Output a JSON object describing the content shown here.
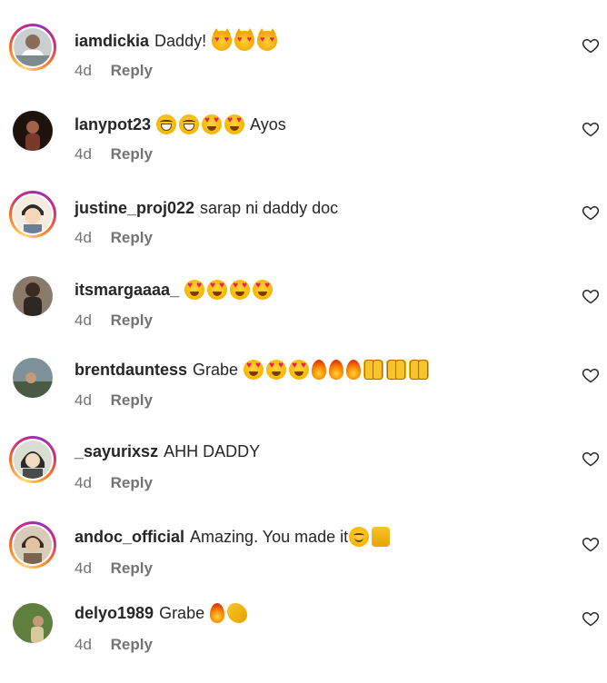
{
  "comments": [
    {
      "username": "iamdickia",
      "text": "Daddy!",
      "emojis": [
        "cat",
        "cat",
        "cat"
      ],
      "time": "4d",
      "reply": "Reply",
      "story": true,
      "avatar_color": "#9aa6a0"
    },
    {
      "username": "lanypot23",
      "text": "Ayos",
      "emojis_before_text": true,
      "emojis": [
        "joy",
        "joy",
        "heart-eyes",
        "heart-eyes"
      ],
      "time": "4d",
      "reply": "Reply",
      "story": false,
      "avatar_color": "#3a2418"
    },
    {
      "username": "justine_proj022",
      "text": "sarap ni daddy doc",
      "emojis": [],
      "time": "4d",
      "reply": "Reply",
      "story": true,
      "avatar_color": "#f2e6d4"
    },
    {
      "username": "itsmargaaaa_",
      "text": "",
      "emojis": [
        "heart-eyes",
        "heart-eyes",
        "heart-eyes",
        "heart-eyes"
      ],
      "time": "4d",
      "reply": "Reply",
      "story": false,
      "avatar_color": "#6b5848"
    },
    {
      "username": "brentdauntess",
      "text": "Grabe",
      "emojis": [
        "heart-eyes",
        "heart-eyes",
        "heart-eyes",
        "fire",
        "fire",
        "fire",
        "raise",
        "raise",
        "raise"
      ],
      "time": "4d",
      "reply": "Reply",
      "story": false,
      "avatar_color": "#6f7f86"
    },
    {
      "username": "_sayurixsz",
      "text": "AHH DADDY",
      "emojis": [],
      "time": "4d",
      "reply": "Reply",
      "story": true,
      "avatar_color": "#cfd3c8"
    },
    {
      "username": "andoc_official",
      "text": "Amazing. You made it",
      "emojis": [
        "smile",
        "thumbs"
      ],
      "time": "4d",
      "reply": "Reply",
      "story": true,
      "avatar_color": "#b8a692"
    },
    {
      "username": "delyo1989",
      "text": "Grabe",
      "emojis": [
        "fire",
        "clap"
      ],
      "time": "4d",
      "reply": "Reply",
      "story": false,
      "avatar_color": "#6d8a4e"
    }
  ],
  "like_icon": "heart-outline-icon",
  "colors": {
    "username": "#262626",
    "meta": "#737373",
    "background": "#ffffff"
  }
}
